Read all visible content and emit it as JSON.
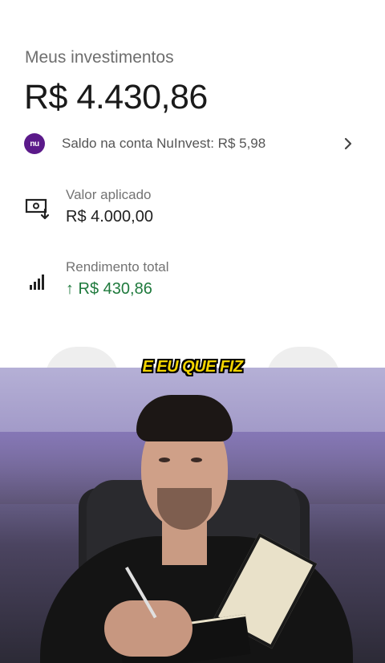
{
  "investments": {
    "section_title": "Meus investimentos",
    "total_balance": "R$ 4.430,86",
    "account": {
      "logo_text": "nu",
      "text": "Saldo na conta NuInvest: R$ 5,98",
      "logo_color": "#5b1a8a"
    },
    "items": [
      {
        "icon": "money-transfer-icon",
        "label": "Valor aplicado",
        "value": "R$ 4.000,00"
      },
      {
        "icon": "signal-bars-icon",
        "label": "Rendimento total",
        "value": "↑ R$ 430,86",
        "value_color": "#1f7a3d"
      }
    ]
  },
  "video": {
    "caption": "E EU QUE FIZ",
    "caption_color": "#f2d400"
  }
}
